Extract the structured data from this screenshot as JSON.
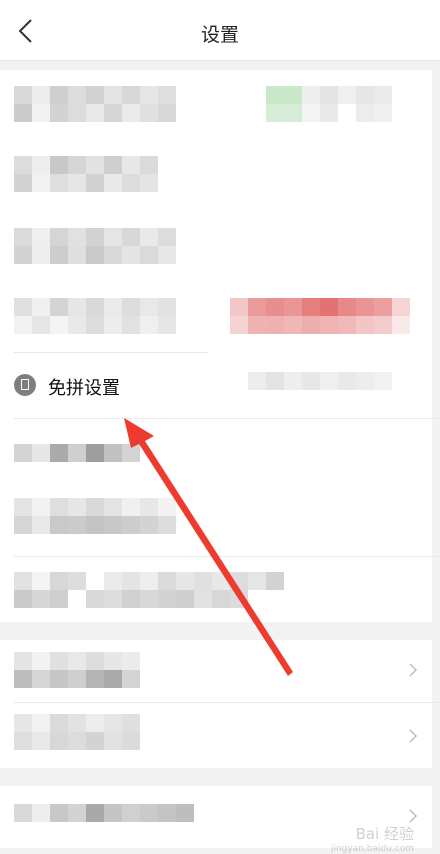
{
  "header": {
    "title": "设置",
    "back_icon": "chevron-left-icon"
  },
  "rows": [
    {
      "label": "免拼设置",
      "icon": "lock-icon"
    }
  ],
  "watermark": {
    "brand": "Bai 经验",
    "url": "jingyan.baidu.com"
  }
}
